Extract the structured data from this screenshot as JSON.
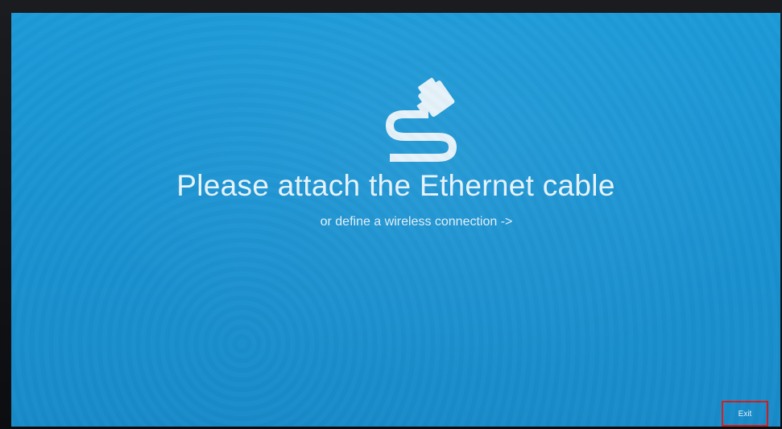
{
  "screen": {
    "icon": "ethernet-cable-icon",
    "title": "Please attach the Ethernet cable",
    "subtitle": "or define a wireless connection ->",
    "exit_label": "Exit",
    "background_color": "#1a93d2",
    "highlight_color": "#d41c1c"
  }
}
